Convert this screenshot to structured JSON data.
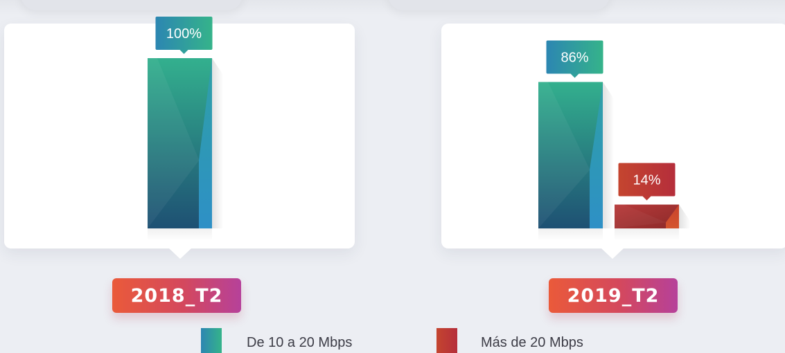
{
  "chart_data": {
    "type": "bar",
    "ylim": [
      0,
      100
    ],
    "series": [
      {
        "name": "De 10 a 20 Mbps",
        "color_top": "#33b08e",
        "color_bottom": "#1e5073",
        "color_side": "#2e90c6"
      },
      {
        "name": "Más de 20 Mbps",
        "color_top": "#c24a33",
        "color_bottom": "#9e2a2a",
        "color_side": "#d24a30"
      }
    ],
    "groups": [
      {
        "period": "2018_T2",
        "values": [
          100,
          null
        ],
        "labels": [
          "100%",
          ""
        ]
      },
      {
        "period": "2019_T2",
        "values": [
          86,
          14
        ],
        "labels": [
          "86%",
          "14%"
        ]
      }
    ]
  },
  "legend": [
    {
      "label": "De 10 a 20 Mbps"
    },
    {
      "label": "Más de 20 Mbps"
    }
  ],
  "periods": [
    "2018_T2",
    "2019_T2"
  ]
}
